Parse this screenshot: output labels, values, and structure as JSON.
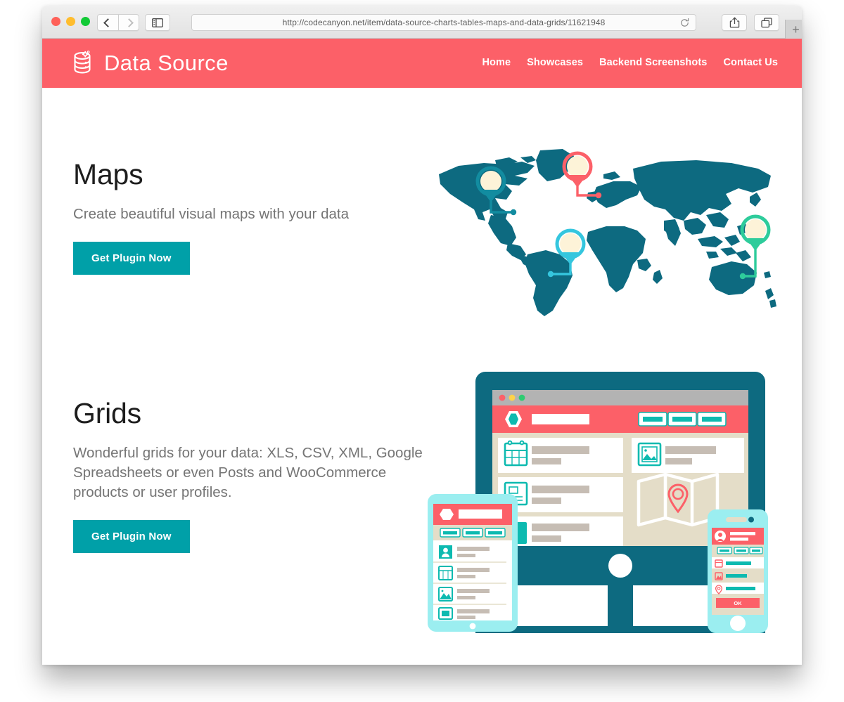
{
  "browser": {
    "url": "http://codecanyon.net/item/data-source-charts-tables-maps-and-data-grids/11621948",
    "back_label": "Back",
    "forward_label": "Forward",
    "sidebar_label": "Show sidebar",
    "reload_label": "Reload",
    "share_label": "Share",
    "tabs_label": "Show all tabs",
    "newtab_label": "+",
    "traffic_lights": [
      "close",
      "minimize",
      "zoom"
    ]
  },
  "site": {
    "brand": {
      "name": "Data Source",
      "icon": "database-gear-icon"
    },
    "nav": [
      {
        "label": "Home"
      },
      {
        "label": "Showcases"
      },
      {
        "label": "Backend Screenshots"
      },
      {
        "label": "Contact Us"
      }
    ]
  },
  "sections": [
    {
      "id": "maps",
      "title": "Maps",
      "description": "Create beautiful visual maps with your data",
      "cta": "Get Plugin Now",
      "illustration": "world-map-with-pins"
    },
    {
      "id": "grids",
      "title": "Grids",
      "description": "Wonderful grids for your data: XLS, CSV, XML, Google Spreadsheets or even Posts and WooCommerce products or user profiles.",
      "cta": "Get Plugin Now",
      "illustration": "responsive-devices-mockup"
    }
  ],
  "illustrations": {
    "map": {
      "land_color": "#0d6a80",
      "pins": [
        {
          "region": "north-america",
          "color": "#128ca0"
        },
        {
          "region": "europe",
          "color": "#fc6068"
        },
        {
          "region": "south-america",
          "color": "#35c6de"
        },
        {
          "region": "oceania",
          "color": "#2ecc9b"
        }
      ],
      "pin_fill": "#fdf3d8"
    },
    "devices": {
      "monitor_frame": "#0d6a80",
      "accent_coral": "#fc6068",
      "accent_teal": "#0dbab0",
      "tablet_frame": "#9beef0",
      "phone_frame": "#9beef0",
      "phone_button_label": "OK",
      "panel_bg": "#e4ddc8"
    }
  },
  "colors": {
    "coral": "#fc6068",
    "teal_button": "#00a0a8",
    "heading": "#1d1d1d",
    "body_text": "#757575",
    "page_bg": "#ffffff"
  }
}
